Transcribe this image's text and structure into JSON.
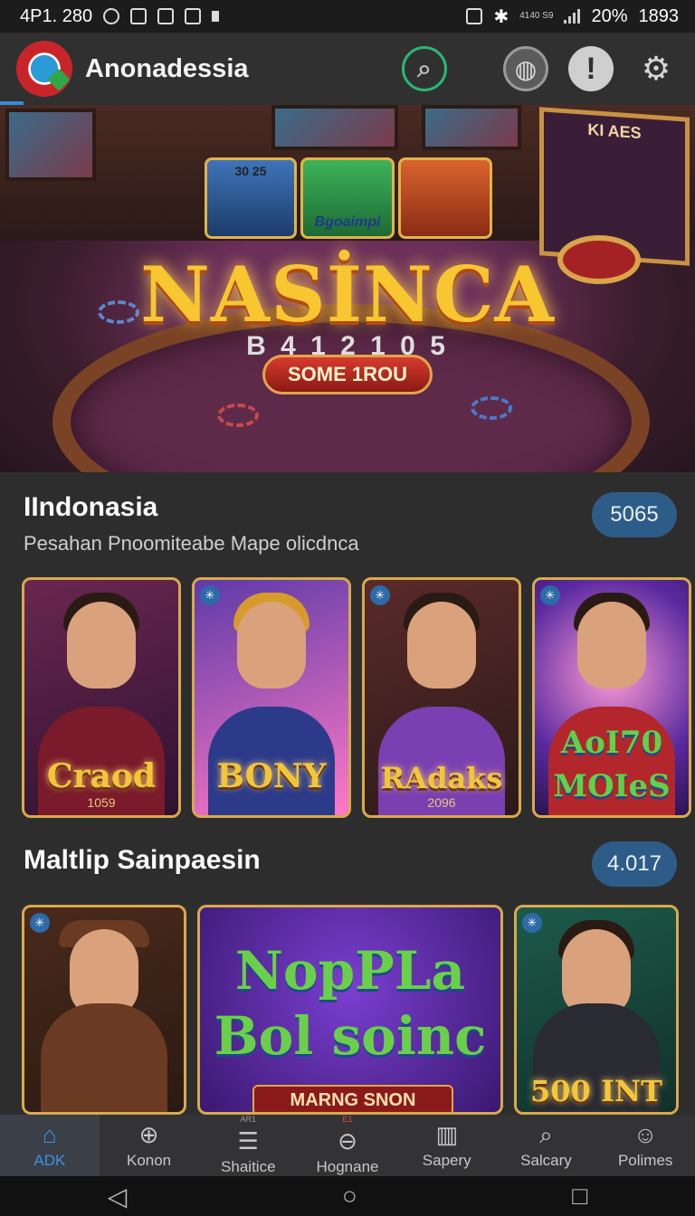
{
  "status_bar": {
    "left_time": "4P1. 280",
    "small_text": "4140 S9",
    "battery": "20%",
    "right_time": "1893"
  },
  "app_bar": {
    "title": "Anonadessia"
  },
  "hero": {
    "logo_text": "NASİNCA",
    "digits": "B 4 1 2 1 0 5",
    "button_label": "SOME 1ROU",
    "slot_title": "KI AES",
    "mini_card_2": "Bgoaimpi",
    "mini_card_1": "30 25"
  },
  "section1": {
    "title": "IIndonasia",
    "subtitle": "Pesahan Pnoomiteabe Mape olicdnca",
    "count": "5065",
    "games": [
      {
        "label": "Craod",
        "sublabel": "1059"
      },
      {
        "label": "BONY",
        "sublabel": ""
      },
      {
        "label": "RAdaks",
        "sublabel": "2096"
      },
      {
        "label": "AoI70 MOIeS",
        "sublabel": ""
      }
    ]
  },
  "section2": {
    "title": "Maltlip Sainpaesin",
    "count": "4.017",
    "games": [
      {
        "label": "",
        "sublabel": ""
      },
      {
        "label": "NopPLa Bol soinc",
        "sublabel": "MARNG SNON"
      },
      {
        "label": "500 INT",
        "sublabel": ""
      }
    ]
  },
  "bottom_nav": [
    {
      "label": "ADK",
      "icon": "home-icon",
      "badge": ""
    },
    {
      "label": "Konon",
      "icon": "compass-icon",
      "badge": ""
    },
    {
      "label": "Shaitice",
      "icon": "list-icon",
      "badge": "AR1"
    },
    {
      "label": "Hognane",
      "icon": "minus-circle-icon",
      "badge": "E1"
    },
    {
      "label": "Sapery",
      "icon": "bars-icon",
      "badge": ""
    },
    {
      "label": "Salcary",
      "icon": "search-icon",
      "badge": ""
    },
    {
      "label": "Polimes",
      "icon": "person-icon",
      "badge": ""
    }
  ],
  "colors": {
    "accent": "#3d93e0",
    "pill": "#2e5c88",
    "gold": "#f3c63a"
  }
}
